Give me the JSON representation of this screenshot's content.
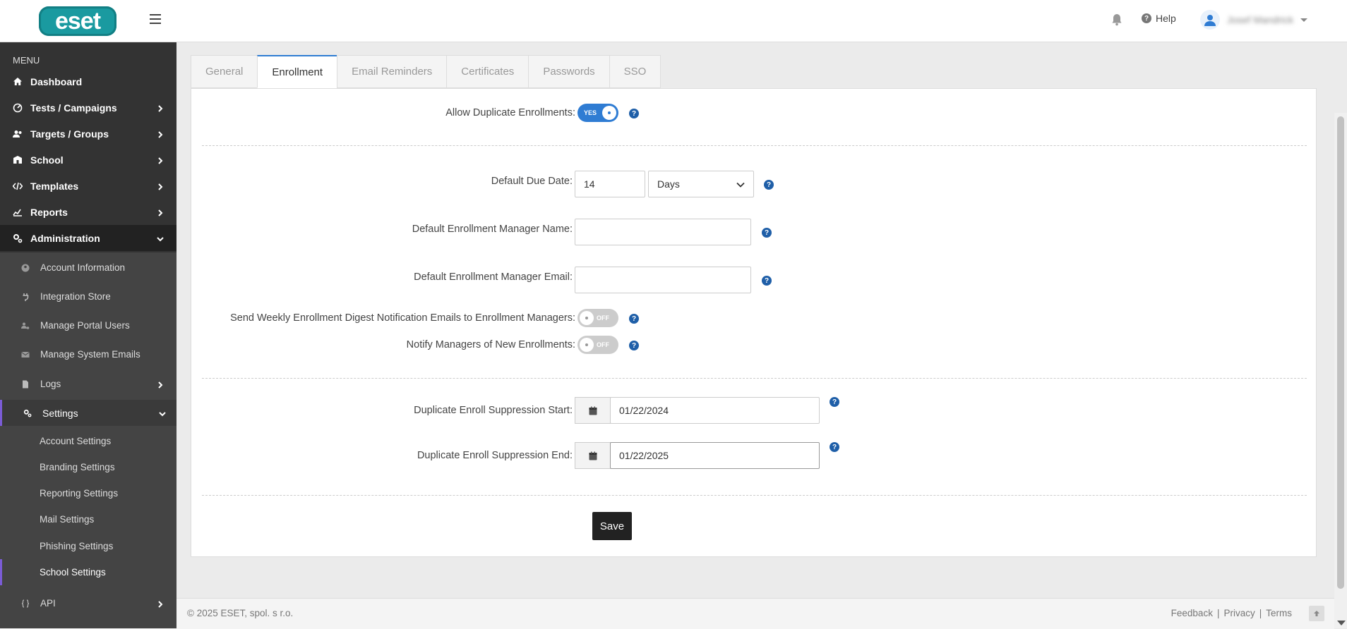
{
  "header": {
    "logo_text": "eset",
    "help_label": "Help",
    "username": "Josef Mandrick"
  },
  "sidebar": {
    "menu_title": "MENU",
    "items": [
      {
        "label": "Dashboard",
        "icon": "home-icon"
      },
      {
        "label": "Tests / Campaigns",
        "icon": "campaign-icon"
      },
      {
        "label": "Targets / Groups",
        "icon": "users-icon"
      },
      {
        "label": "School",
        "icon": "school-icon"
      },
      {
        "label": "Templates",
        "icon": "code-icon"
      },
      {
        "label": "Reports",
        "icon": "chart-icon"
      },
      {
        "label": "Administration",
        "icon": "gears-icon"
      }
    ],
    "admin_items": [
      {
        "label": "Account Information",
        "icon": "user-circle-icon"
      },
      {
        "label": "Integration Store",
        "icon": "plug-icon"
      },
      {
        "label": "Manage Portal Users",
        "icon": "users-cog-icon"
      },
      {
        "label": "Manage System Emails",
        "icon": "envelope-icon"
      },
      {
        "label": "Logs",
        "icon": "file-icon"
      },
      {
        "label": "Settings",
        "icon": "settings-icon"
      }
    ],
    "settings_items": [
      {
        "label": "Account Settings"
      },
      {
        "label": "Branding Settings"
      },
      {
        "label": "Reporting Settings"
      },
      {
        "label": "Mail Settings"
      },
      {
        "label": "Phishing Settings"
      },
      {
        "label": "School Settings"
      }
    ],
    "api_label": "API"
  },
  "tabs": [
    "General",
    "Enrollment",
    "Email Reminders",
    "Certificates",
    "Passwords",
    "SSO"
  ],
  "active_tab": "Enrollment",
  "form": {
    "allow_duplicate_label": "Allow Duplicate Enrollments:",
    "allow_duplicate_toggle": "YES",
    "due_date_label": "Default Due Date:",
    "due_date_value": "14",
    "due_date_unit": "Days",
    "manager_name_label": "Default Enrollment Manager Name:",
    "manager_name_value": "",
    "manager_email_label": "Default Enrollment Manager Email:",
    "manager_email_value": "",
    "weekly_digest_label": "Send Weekly Enrollment Digest Notification Emails to Enrollment Managers:",
    "weekly_digest_toggle": "OFF",
    "notify_managers_label": "Notify Managers of New Enrollments:",
    "notify_managers_toggle": "OFF",
    "suppression_start_label": "Duplicate Enroll Suppression Start:",
    "suppression_start_value": "01/22/2024",
    "suppression_end_label": "Duplicate Enroll Suppression End:",
    "suppression_end_value": "01/22/2025",
    "save_label": "Save",
    "hint_glyph": "?"
  },
  "footer": {
    "copyright": "© 2025 ESET, spol. s r.o.",
    "feedback": "Feedback",
    "privacy": "Privacy",
    "terms": "Terms",
    "separator": "|"
  },
  "colors": {
    "accent": "#2f7cd3",
    "sidebar_bg": "#333333",
    "brand": "#1a9aa0",
    "active_marker": "#7b5cd6"
  }
}
